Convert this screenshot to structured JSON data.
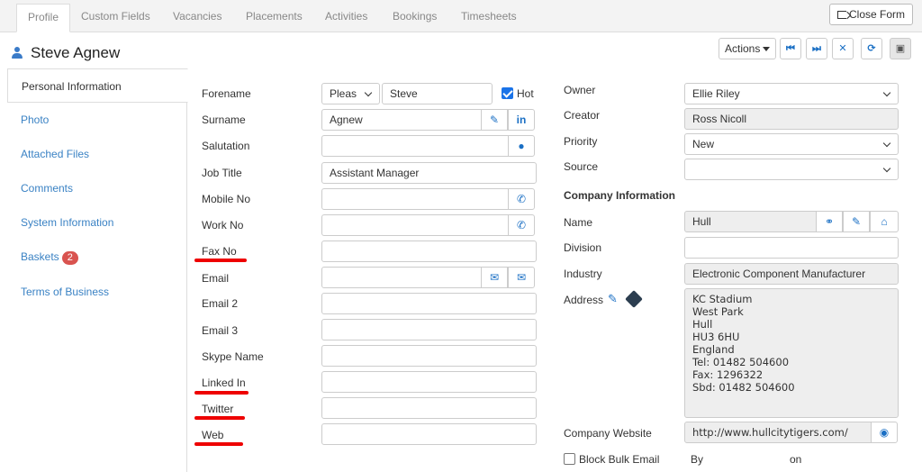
{
  "tabs": [
    "Profile",
    "Custom Fields",
    "Vacancies",
    "Placements",
    "Activities",
    "Bookings",
    "Timesheets"
  ],
  "close_form": "Close Form",
  "candidate_name": "Steve Agnew",
  "actions_label": "Actions",
  "sidebar": [
    "Personal Information",
    "Photo",
    "Attached Files",
    "Comments",
    "System Information",
    "Baskets",
    "Terms of Business"
  ],
  "basket_count": "2",
  "form": {
    "labels": [
      "Forename",
      "Surname",
      "Salutation",
      "Job Title",
      "Mobile No",
      "Work No",
      "Fax No",
      "Email",
      "Email 2",
      "Email 3",
      "Skype Name",
      "Linked In",
      "Twitter",
      "Web"
    ],
    "title_select": "Pleas",
    "forename": "Steve",
    "hot_label": "Hot",
    "surname": "Agnew",
    "job_title": "Assistant Manager"
  },
  "right": {
    "owner_label": "Owner",
    "owner": "Ellie Riley",
    "creator_label": "Creator",
    "creator": "Ross Nicoll",
    "priority_label": "Priority",
    "priority": "New",
    "source_label": "Source",
    "source": "",
    "company_section": "Company Information",
    "name_label": "Name",
    "company_name": "Hull",
    "division_label": "Division",
    "industry_label": "Industry",
    "industry": "Electronic Component Manufacturer",
    "address_label": "Address",
    "address": "KC Stadium\nWest Park\nHull\nHU3 6HU\nEngland\nTel: 01482 504600\nFax: 1296322\nSbd: 01482 504600",
    "website_label": "Company Website",
    "website": "http://www.hullcitytigers.com/",
    "block_bulk_email": "Block Bulk Email",
    "by_label": "By",
    "on_label": "on"
  },
  "colors": {
    "accent": "#1a6fc4",
    "link": "#3a82c4",
    "badge": "#d9534f",
    "underline": "#e00000"
  }
}
